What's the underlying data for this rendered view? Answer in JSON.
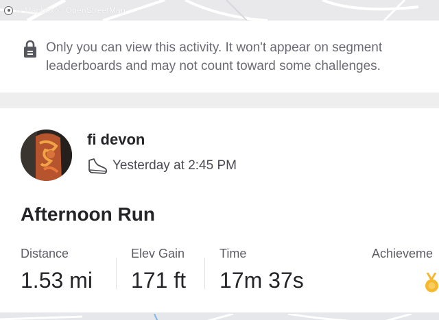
{
  "map": {
    "attribution": "© Mapbox © OpenStreetMap",
    "logo_icon": "mapbox-logo-icon"
  },
  "privacy_notice": {
    "icon": "lock-icon",
    "text": "Only you can view this activity. It won't appear on segment leaderboards and may not count toward some challenges."
  },
  "activity": {
    "athlete_name": "fi devon",
    "sport_icon": "shoe-icon",
    "timestamp": "Yesterday at 2:45 PM",
    "title": "Afternoon Run",
    "stats": [
      {
        "label": "Distance",
        "value": "1.53 mi"
      },
      {
        "label": "Elev Gain",
        "value": "171 ft"
      },
      {
        "label": "Time",
        "value": "17m 37s"
      },
      {
        "label": "Achieveme",
        "value": ""
      }
    ],
    "achievement_icon": "medal-icon"
  },
  "colors": {
    "accent": "#f5b82e",
    "text_primary": "#242428",
    "text_secondary": "#6b6b73",
    "page_background": "#eeeeef"
  }
}
